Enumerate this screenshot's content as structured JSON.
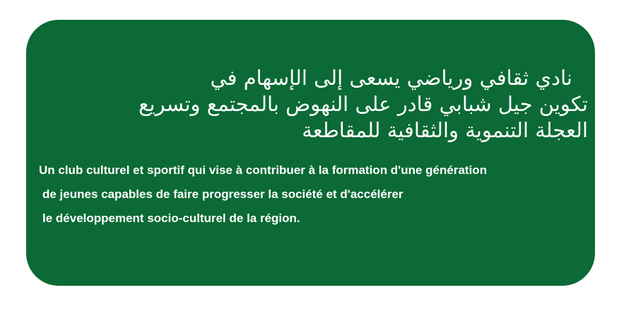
{
  "banner": {
    "background_color": "#0b6a35",
    "text_color": "#ffffff",
    "arabic_lines": [
      "نادي ثقافي ورياضي يسعى إلى الإسهام في",
      "تكوين جيل شبابي قادر على النهوض بالمجتمع وتسريع",
      "العجلة التنموية والثقافية للمقاطعة"
    ],
    "french_lines": [
      "Un club culturel et sportif qui vise à contribuer à la formation d'une génération",
      "de jeunes capables de faire progresser la société et d'accélérer",
      "le développement socio-culturel de la région."
    ]
  }
}
